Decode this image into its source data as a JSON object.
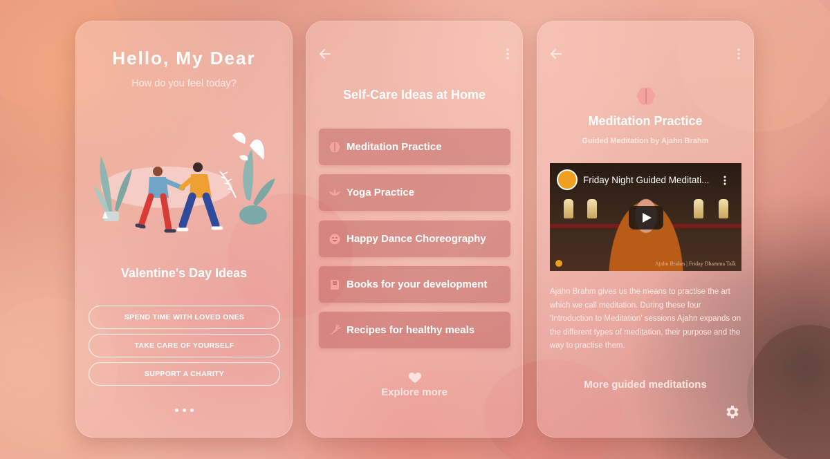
{
  "card1": {
    "title": "Hello, My Dear",
    "subtitle": "How do you feel today?",
    "illustration_icon": "couple-walking-illustration",
    "heading": "Valentine's Day Ideas",
    "buttons": [
      "SPEND TIME WITH LOVED ONES",
      "TAKE CARE OF YOURSELF",
      "SUPPORT A CHARITY"
    ],
    "pagination_icon": "pagination-dots"
  },
  "card2": {
    "back_icon": "arrow-left-icon",
    "menu_icon": "kebab-menu-icon",
    "title": "Self-Care Ideas at Home",
    "items": [
      {
        "label": "Meditation Practice",
        "icon": "brain-icon"
      },
      {
        "label": "Yoga Practice",
        "icon": "lotus-icon"
      },
      {
        "label": "Happy Dance Choreography",
        "icon": "smile-icon"
      },
      {
        "label": "Books for your development",
        "icon": "book-icon"
      },
      {
        "label": "Recipes for healthy meals",
        "icon": "carrot-icon"
      }
    ],
    "explore_label": "Explore more",
    "explore_icon": "heart-icon"
  },
  "card3": {
    "back_icon": "arrow-left-icon",
    "menu_icon": "kebab-menu-icon",
    "icon": "brain-icon",
    "title": "Meditation Practice",
    "subtitle": "Guided Meditation by Ajahn Brahm",
    "video": {
      "title": "Friday Night Guided Meditati...",
      "caption": "Ajahn Brahm | Friday Dhamma Talk"
    },
    "description": "Ajahn Brahm gives us the means to practise the art which we call meditation. During these four 'Introduction to Meditation' sessions Ajahn expands on the different types of meditation, their purpose and the way to practise them.",
    "more_label": "More guided meditations",
    "settings_icon": "gear-icon"
  },
  "colors": {
    "accent_pink": "#f4a3a0",
    "item_bg": "#b45050",
    "text": "#ffffff"
  }
}
